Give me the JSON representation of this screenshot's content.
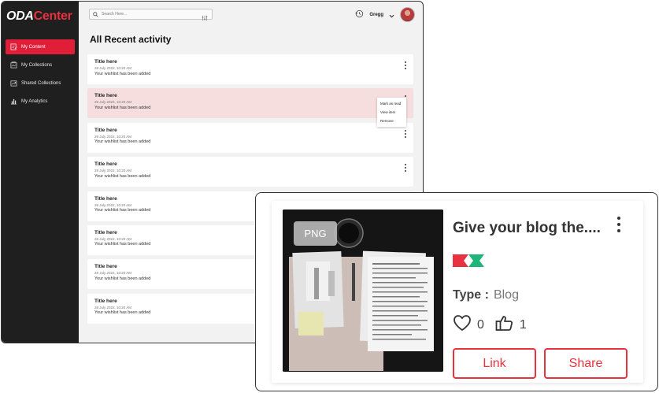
{
  "app": {
    "logo_prefix": "ODA",
    "logo_brand": "Center"
  },
  "sidebar": {
    "items": [
      {
        "label": "My Content",
        "icon": "document-edit-icon",
        "active": true
      },
      {
        "label": "My Collections",
        "icon": "collection-icon",
        "active": false
      },
      {
        "label": "Shared Collections",
        "icon": "shared-collection-icon",
        "active": false
      },
      {
        "label": "My Analytics",
        "icon": "bar-chart-icon",
        "active": false
      }
    ]
  },
  "header": {
    "search_placeholder": "Search Here...",
    "user_name": "Gregg"
  },
  "main": {
    "title": "All Recent activity",
    "activities": [
      {
        "title": "Title here",
        "date": "28 July 2022, 10:20 AM",
        "text": "Your wishlist has been added"
      },
      {
        "title": "Title here",
        "date": "28 July 2022, 10:20 AM",
        "text": "Your wishlist has been added"
      },
      {
        "title": "Title here",
        "date": "28 July 2022, 10:20 AM",
        "text": "Your wishlist has been added"
      },
      {
        "title": "Title here",
        "date": "28 July 2022, 10:20 AM",
        "text": "Your wishlist has been added"
      },
      {
        "title": "Title here",
        "date": "28 July 2022, 10:20 AM",
        "text": "Your wishlist has been added"
      },
      {
        "title": "Title here",
        "date": "28 July 2022, 10:20 AM",
        "text": "Your wishlist has been added"
      },
      {
        "title": "Title here",
        "date": "28 July 2022, 10:20 AM",
        "text": "Your wishlist has been added"
      },
      {
        "title": "Title here",
        "date": "28 July 2022, 10:20 AM",
        "text": "Your wishlist has been added"
      }
    ],
    "context_menu": [
      "Mark as read",
      "View item",
      "Remove"
    ]
  },
  "card": {
    "badge": "PNG",
    "title": "Give your blog the....",
    "type_label": "Type :",
    "type_value": "Blog",
    "likes": "0",
    "thumbs": "1",
    "link_label": "Link",
    "share_label": "Share"
  },
  "colors": {
    "accent": "#e8323f",
    "sidebar_bg": "#1f1f1f",
    "active_nav": "#e01e37",
    "highlight_row": "#f6dede",
    "flag_green": "#1fb47a"
  }
}
